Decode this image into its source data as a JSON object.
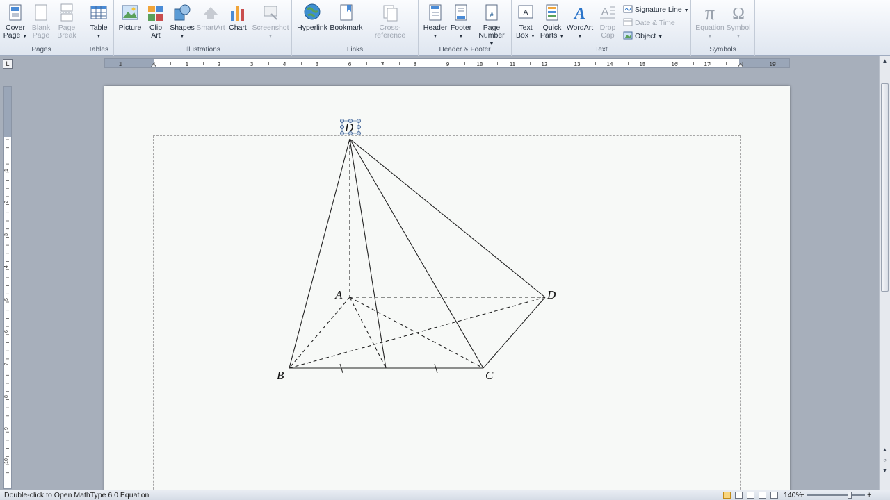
{
  "ribbon": {
    "pages": {
      "label": "Pages",
      "cover": "Cover",
      "cover2": "Page",
      "blank": "Blank",
      "blank2": "Page",
      "break": "Page",
      "break2": "Break"
    },
    "tables": {
      "label": "Tables",
      "table": "Table"
    },
    "illustrations": {
      "label": "Illustrations",
      "picture": "Picture",
      "clip": "Clip",
      "clip2": "Art",
      "shapes": "Shapes",
      "smartart": "SmartArt",
      "chart": "Chart",
      "screenshot": "Screenshot"
    },
    "links": {
      "label": "Links",
      "hyperlink": "Hyperlink",
      "bookmark": "Bookmark",
      "crossref": "Cross-reference"
    },
    "header_footer": {
      "label": "Header & Footer",
      "header": "Header",
      "footer": "Footer",
      "page_number": "Page",
      "page_number2": "Number"
    },
    "text": {
      "label": "Text",
      "text_box": "Text",
      "text_box2": "Box",
      "quick_parts": "Quick",
      "quick_parts2": "Parts",
      "wordart": "WordArt",
      "drop_cap": "Drop",
      "drop_cap2": "Cap",
      "signature_line": "Signature Line",
      "date_time": "Date & Time",
      "object": "Object"
    },
    "symbols": {
      "label": "Symbols",
      "equation": "Equation",
      "symbol": "Symbol"
    }
  },
  "ruler": {
    "numbers": [
      "1",
      "1",
      "2",
      "3",
      "4",
      "5",
      "6",
      "7",
      "8",
      "9",
      "10",
      "11",
      "12",
      "13",
      "14",
      "15",
      "16",
      "17",
      "19"
    ],
    "corner": "L",
    "v_numbers": [
      "1",
      "1",
      "2",
      "3",
      "4",
      "5",
      "6",
      "7",
      "8",
      "9",
      "10"
    ]
  },
  "figure": {
    "labels": {
      "S": "D",
      "A": "A",
      "B": "B",
      "C": "C",
      "D": "D"
    }
  },
  "status": {
    "text": "Double-click to Open MathType 6.0 Equation",
    "zoom": "140%"
  },
  "colors": {
    "ribbon_bg": "#dfe6f0",
    "page_bg": "#f7f9f7",
    "frame_bg": "#a7afbb"
  }
}
